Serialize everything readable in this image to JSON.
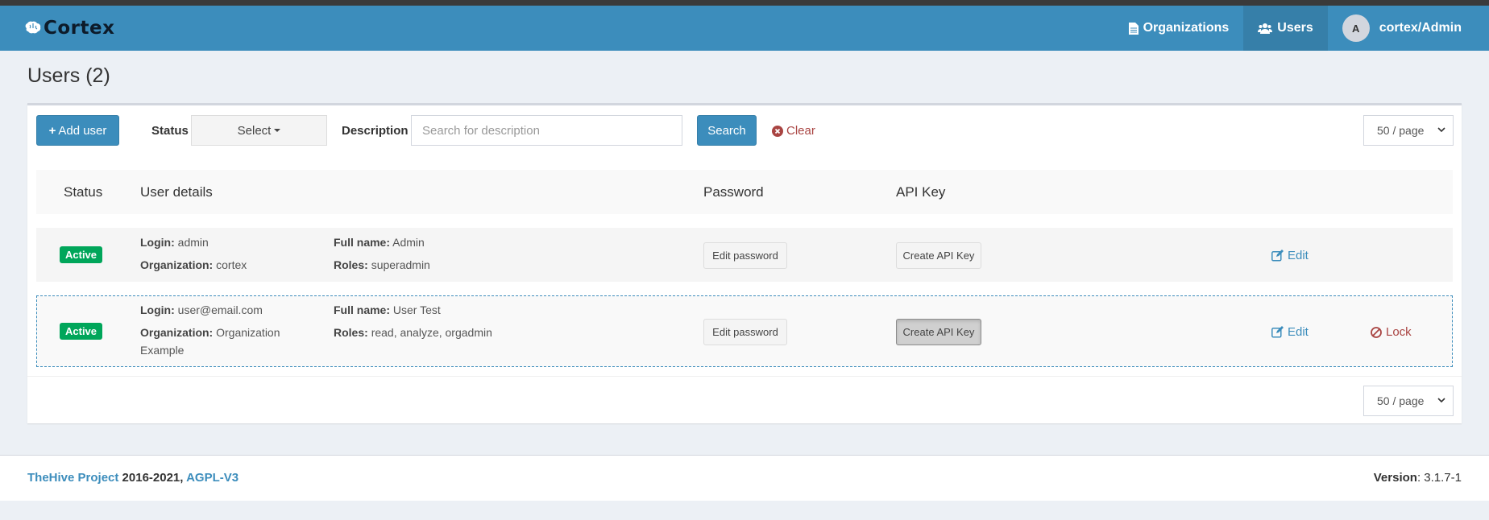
{
  "app": {
    "brand": "Cortex"
  },
  "nav": {
    "organizations": "Organizations",
    "users": "Users",
    "avatar_initial": "A",
    "account": "cortex/Admin"
  },
  "page": {
    "title": "Users (2)"
  },
  "toolbar": {
    "add_user": "Add user",
    "status_label": "Status",
    "status_select": "Select",
    "description_label": "Description",
    "description_placeholder": "Search for description",
    "search": "Search",
    "clear": "Clear",
    "page_size": "50 / page"
  },
  "table": {
    "headers": [
      "Status",
      "User details",
      "Password",
      "API Key"
    ],
    "rows": [
      {
        "status": "Active",
        "login_label": "Login:",
        "login": "admin",
        "org_label": "Organization:",
        "org": "cortex",
        "fullname_label": "Full name:",
        "fullname": "Admin",
        "roles_label": "Roles:",
        "roles": "superadmin",
        "edit_password": "Edit password",
        "create_api_key": "Create API Key",
        "edit": "Edit"
      },
      {
        "status": "Active",
        "login_label": "Login:",
        "login": "user@email.com",
        "org_label": "Organization:",
        "org": "Organization Example",
        "fullname_label": "Full name:",
        "fullname": "User Test",
        "roles_label": "Roles:",
        "roles": "read, analyze, orgadmin",
        "edit_password": "Edit password",
        "create_api_key": "Create API Key",
        "edit": "Edit",
        "lock": "Lock"
      }
    ]
  },
  "footer": {
    "project_link": "TheHive Project",
    "years": " 2016-2021, ",
    "license_link": "AGPL-V3",
    "version_label": "Version",
    "version": ": 3.1.7-1"
  },
  "colors": {
    "primary": "#3c8dbc",
    "navbar": "#3c8dbc",
    "success": "#00a65a",
    "danger": "#a94442"
  }
}
